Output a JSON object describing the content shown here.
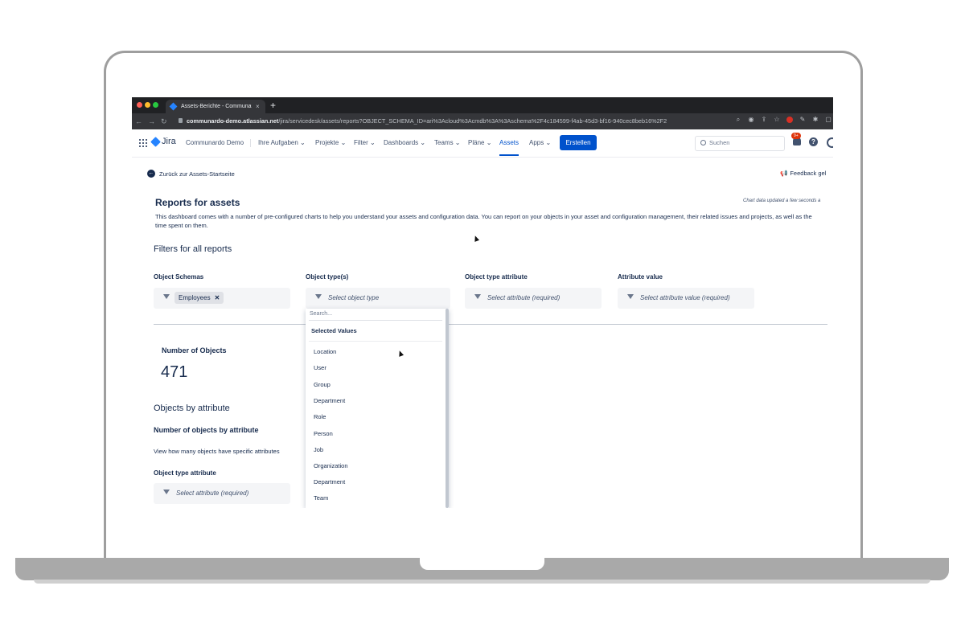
{
  "browser": {
    "tab_title": "Assets-Berichte - Communardo",
    "tab_close": "×",
    "new_tab": "+",
    "url_host": "communardo-demo.atlassian.net",
    "url_path": "/jira/servicedesk/assets/reports?OBJECT_SCHEMA_ID=ari%3Acloud%3Acmdb%3A%3Aschema%2F4c184599-f4ab-45d3-bf16-940cec8beb16%2F2",
    "colors": {
      "close": "#ff5f57",
      "minimize": "#febc2e",
      "maximize": "#28c840"
    }
  },
  "jira": {
    "logo_text": "Jira",
    "project": "Communardo Demo",
    "nav": [
      "Ihre Aufgaben",
      "Projekte",
      "Filter",
      "Dashboards",
      "Teams",
      "Pläne",
      "Assets",
      "Apps"
    ],
    "active_nav": "Assets",
    "create_label": "Erstellen",
    "search_placeholder": "Suchen",
    "notif_badge": "9+",
    "help": "?",
    "accent": "#0052cc"
  },
  "page": {
    "back_label": "Zurück zur Assets-Startseite",
    "feedback_label": "Feedback gel",
    "updated_note": "Chart data updated a few seconds a",
    "title": "Reports for assets",
    "description": "This dashboard comes with a number of pre-configured charts to help you understand your assets and configuration data. You can report on your objects in your asset and configuration management, their related issues and projects, as well as the time spent on them.",
    "filters_heading": "Filters for all reports",
    "filters": {
      "schemas_label": "Object Schemas",
      "schema_chip": "Employees",
      "chip_remove": "✕",
      "types_label": "Object type(s)",
      "types_placeholder": "Select object type",
      "attr_label": "Object type attribute",
      "attr_placeholder": "Select attribute (required)",
      "value_label": "Attribute value",
      "value_placeholder": "Select attribute value (required)"
    },
    "count_title": "Number of Objects",
    "count_value": "471",
    "by_attr_heading": "Objects by attribute",
    "by_attr_subheading": "Number of objects by attribute",
    "by_attr_desc": "View how many objects have specific attributes",
    "by_attr_label": "Object type attribute",
    "by_attr_placeholder": "Select attribute (required)"
  },
  "dropdown": {
    "search_placeholder": "Search...",
    "heading": "Selected Values",
    "items": [
      "Location",
      "User",
      "Group",
      "Department",
      "Role",
      "Person",
      "Job",
      "Organization",
      "Department",
      "Team"
    ]
  }
}
